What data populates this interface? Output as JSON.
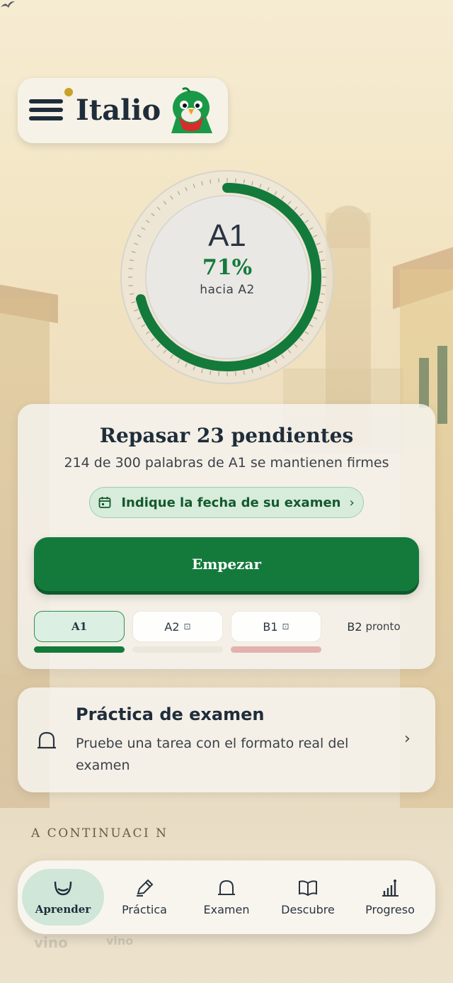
{
  "app": {
    "name": "Italio"
  },
  "icons": {
    "menu": "hamburger-menu-icon",
    "notification": "notification-dot",
    "mascot": "parrot-mascot",
    "calendar": "calendar-icon",
    "bell": "bell-icon",
    "chevron": "chevron-right-icon"
  },
  "colors": {
    "primary_green": "#137a3c",
    "light_green": "#dbefe2",
    "navy": "#1f2d3a",
    "notification_gold": "#c9a227",
    "locked_bar": "#ece7dd",
    "b1_bar": "#e3b2ae"
  },
  "progress": {
    "level": "A1",
    "percent_label": "71%",
    "percent_value": 0.71,
    "target": "hacia A2"
  },
  "review": {
    "title": "Repasar 23 pendientes",
    "subtitle": "214 de 300 palabras de A1 se mantienen firmes",
    "exam_date_label": "Indique la fecha de su examen",
    "chevron": "›",
    "start_label": "Empezar"
  },
  "levels": [
    {
      "label": "A1",
      "state": "active",
      "progress": 1.0
    },
    {
      "label": "A2",
      "state": "locked",
      "lock": "🔒"
    },
    {
      "label": "B1",
      "state": "locked",
      "lock": "🔒"
    },
    {
      "label": "B2",
      "state": "soon",
      "badge": "pronto"
    }
  ],
  "practice": {
    "title": "Práctica de examen",
    "subtitle": "Pruebe una tarea con el formato real del examen",
    "chevron": "›"
  },
  "section": {
    "heading": "A CONTINUACI N"
  },
  "nav": [
    {
      "label": "Aprender",
      "icon": "smile-icon",
      "active": true
    },
    {
      "label": "Práctica",
      "icon": "pencil-icon",
      "active": false
    },
    {
      "label": "Examen",
      "icon": "bell-icon",
      "active": false
    },
    {
      "label": "Descubre",
      "icon": "book-icon",
      "active": false
    },
    {
      "label": "Progreso",
      "icon": "bar-chart-icon",
      "active": false
    }
  ],
  "ghost": {
    "text1": "vino",
    "text2": "vino"
  }
}
